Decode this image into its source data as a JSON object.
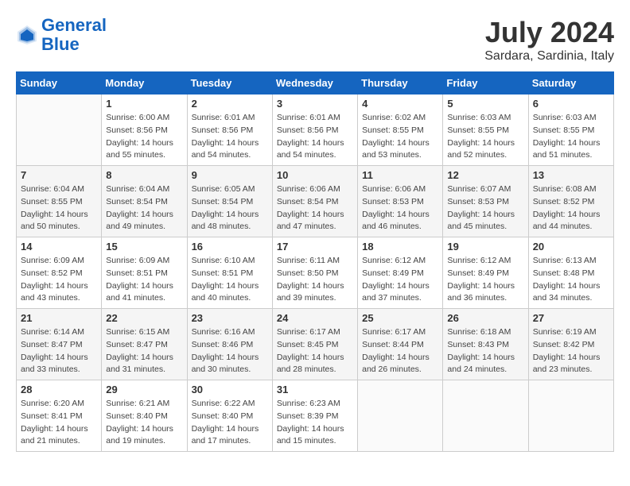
{
  "header": {
    "logo_line1": "General",
    "logo_line2": "Blue",
    "month_year": "July 2024",
    "location": "Sardara, Sardinia, Italy"
  },
  "calendar": {
    "days_of_week": [
      "Sunday",
      "Monday",
      "Tuesday",
      "Wednesday",
      "Thursday",
      "Friday",
      "Saturday"
    ],
    "weeks": [
      [
        {
          "day": "",
          "sunrise": "",
          "sunset": "",
          "daylight": ""
        },
        {
          "day": "1",
          "sunrise": "Sunrise: 6:00 AM",
          "sunset": "Sunset: 8:56 PM",
          "daylight": "Daylight: 14 hours and 55 minutes."
        },
        {
          "day": "2",
          "sunrise": "Sunrise: 6:01 AM",
          "sunset": "Sunset: 8:56 PM",
          "daylight": "Daylight: 14 hours and 54 minutes."
        },
        {
          "day": "3",
          "sunrise": "Sunrise: 6:01 AM",
          "sunset": "Sunset: 8:56 PM",
          "daylight": "Daylight: 14 hours and 54 minutes."
        },
        {
          "day": "4",
          "sunrise": "Sunrise: 6:02 AM",
          "sunset": "Sunset: 8:55 PM",
          "daylight": "Daylight: 14 hours and 53 minutes."
        },
        {
          "day": "5",
          "sunrise": "Sunrise: 6:03 AM",
          "sunset": "Sunset: 8:55 PM",
          "daylight": "Daylight: 14 hours and 52 minutes."
        },
        {
          "day": "6",
          "sunrise": "Sunrise: 6:03 AM",
          "sunset": "Sunset: 8:55 PM",
          "daylight": "Daylight: 14 hours and 51 minutes."
        }
      ],
      [
        {
          "day": "7",
          "sunrise": "Sunrise: 6:04 AM",
          "sunset": "Sunset: 8:55 PM",
          "daylight": "Daylight: 14 hours and 50 minutes."
        },
        {
          "day": "8",
          "sunrise": "Sunrise: 6:04 AM",
          "sunset": "Sunset: 8:54 PM",
          "daylight": "Daylight: 14 hours and 49 minutes."
        },
        {
          "day": "9",
          "sunrise": "Sunrise: 6:05 AM",
          "sunset": "Sunset: 8:54 PM",
          "daylight": "Daylight: 14 hours and 48 minutes."
        },
        {
          "day": "10",
          "sunrise": "Sunrise: 6:06 AM",
          "sunset": "Sunset: 8:54 PM",
          "daylight": "Daylight: 14 hours and 47 minutes."
        },
        {
          "day": "11",
          "sunrise": "Sunrise: 6:06 AM",
          "sunset": "Sunset: 8:53 PM",
          "daylight": "Daylight: 14 hours and 46 minutes."
        },
        {
          "day": "12",
          "sunrise": "Sunrise: 6:07 AM",
          "sunset": "Sunset: 8:53 PM",
          "daylight": "Daylight: 14 hours and 45 minutes."
        },
        {
          "day": "13",
          "sunrise": "Sunrise: 6:08 AM",
          "sunset": "Sunset: 8:52 PM",
          "daylight": "Daylight: 14 hours and 44 minutes."
        }
      ],
      [
        {
          "day": "14",
          "sunrise": "Sunrise: 6:09 AM",
          "sunset": "Sunset: 8:52 PM",
          "daylight": "Daylight: 14 hours and 43 minutes."
        },
        {
          "day": "15",
          "sunrise": "Sunrise: 6:09 AM",
          "sunset": "Sunset: 8:51 PM",
          "daylight": "Daylight: 14 hours and 41 minutes."
        },
        {
          "day": "16",
          "sunrise": "Sunrise: 6:10 AM",
          "sunset": "Sunset: 8:51 PM",
          "daylight": "Daylight: 14 hours and 40 minutes."
        },
        {
          "day": "17",
          "sunrise": "Sunrise: 6:11 AM",
          "sunset": "Sunset: 8:50 PM",
          "daylight": "Daylight: 14 hours and 39 minutes."
        },
        {
          "day": "18",
          "sunrise": "Sunrise: 6:12 AM",
          "sunset": "Sunset: 8:49 PM",
          "daylight": "Daylight: 14 hours and 37 minutes."
        },
        {
          "day": "19",
          "sunrise": "Sunrise: 6:12 AM",
          "sunset": "Sunset: 8:49 PM",
          "daylight": "Daylight: 14 hours and 36 minutes."
        },
        {
          "day": "20",
          "sunrise": "Sunrise: 6:13 AM",
          "sunset": "Sunset: 8:48 PM",
          "daylight": "Daylight: 14 hours and 34 minutes."
        }
      ],
      [
        {
          "day": "21",
          "sunrise": "Sunrise: 6:14 AM",
          "sunset": "Sunset: 8:47 PM",
          "daylight": "Daylight: 14 hours and 33 minutes."
        },
        {
          "day": "22",
          "sunrise": "Sunrise: 6:15 AM",
          "sunset": "Sunset: 8:47 PM",
          "daylight": "Daylight: 14 hours and 31 minutes."
        },
        {
          "day": "23",
          "sunrise": "Sunrise: 6:16 AM",
          "sunset": "Sunset: 8:46 PM",
          "daylight": "Daylight: 14 hours and 30 minutes."
        },
        {
          "day": "24",
          "sunrise": "Sunrise: 6:17 AM",
          "sunset": "Sunset: 8:45 PM",
          "daylight": "Daylight: 14 hours and 28 minutes."
        },
        {
          "day": "25",
          "sunrise": "Sunrise: 6:17 AM",
          "sunset": "Sunset: 8:44 PM",
          "daylight": "Daylight: 14 hours and 26 minutes."
        },
        {
          "day": "26",
          "sunrise": "Sunrise: 6:18 AM",
          "sunset": "Sunset: 8:43 PM",
          "daylight": "Daylight: 14 hours and 24 minutes."
        },
        {
          "day": "27",
          "sunrise": "Sunrise: 6:19 AM",
          "sunset": "Sunset: 8:42 PM",
          "daylight": "Daylight: 14 hours and 23 minutes."
        }
      ],
      [
        {
          "day": "28",
          "sunrise": "Sunrise: 6:20 AM",
          "sunset": "Sunset: 8:41 PM",
          "daylight": "Daylight: 14 hours and 21 minutes."
        },
        {
          "day": "29",
          "sunrise": "Sunrise: 6:21 AM",
          "sunset": "Sunset: 8:40 PM",
          "daylight": "Daylight: 14 hours and 19 minutes."
        },
        {
          "day": "30",
          "sunrise": "Sunrise: 6:22 AM",
          "sunset": "Sunset: 8:40 PM",
          "daylight": "Daylight: 14 hours and 17 minutes."
        },
        {
          "day": "31",
          "sunrise": "Sunrise: 6:23 AM",
          "sunset": "Sunset: 8:39 PM",
          "daylight": "Daylight: 14 hours and 15 minutes."
        },
        {
          "day": "",
          "sunrise": "",
          "sunset": "",
          "daylight": ""
        },
        {
          "day": "",
          "sunrise": "",
          "sunset": "",
          "daylight": ""
        },
        {
          "day": "",
          "sunrise": "",
          "sunset": "",
          "daylight": ""
        }
      ]
    ]
  }
}
